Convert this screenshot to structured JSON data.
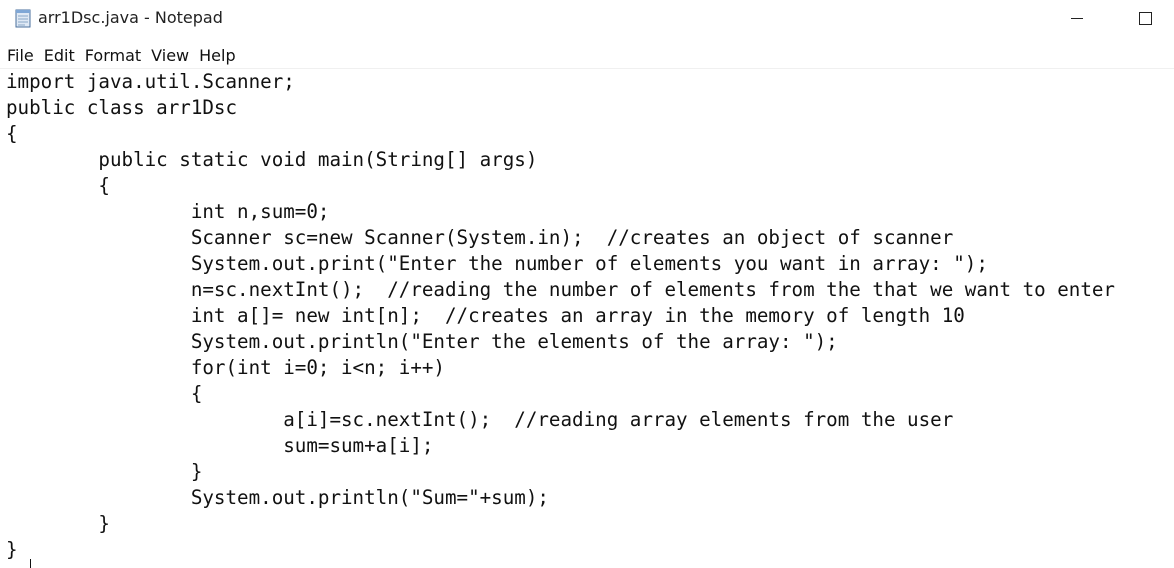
{
  "window": {
    "title": "arr1Dsc.java - Notepad"
  },
  "icons": {
    "app": "notepad-icon",
    "minimize": "minimize-icon",
    "maximize": "maximize-icon"
  },
  "menu": {
    "items": [
      "File",
      "Edit",
      "Format",
      "View",
      "Help"
    ]
  },
  "editor": {
    "lines": [
      "import java.util.Scanner;",
      "public class arr1Dsc",
      "{",
      "        public static void main(String[] args)",
      "        {",
      "                int n,sum=0;",
      "                Scanner sc=new Scanner(System.in);  //creates an object of scanner",
      "                System.out.print(\"Enter the number of elements you want in array: \");",
      "                n=sc.nextInt();  //reading the number of elements from the that we want to enter",
      "                int a[]= new int[n];  //creates an array in the memory of length 10",
      "                System.out.println(\"Enter the elements of the array: \");",
      "                for(int i=0; i<n; i++)",
      "                {",
      "                        a[i]=sc.nextInt();  //reading array elements from the user",
      "                        sum=sum+a[i];",
      "                }",
      "                System.out.println(\"Sum=\"+sum);",
      "        }",
      "}"
    ]
  }
}
